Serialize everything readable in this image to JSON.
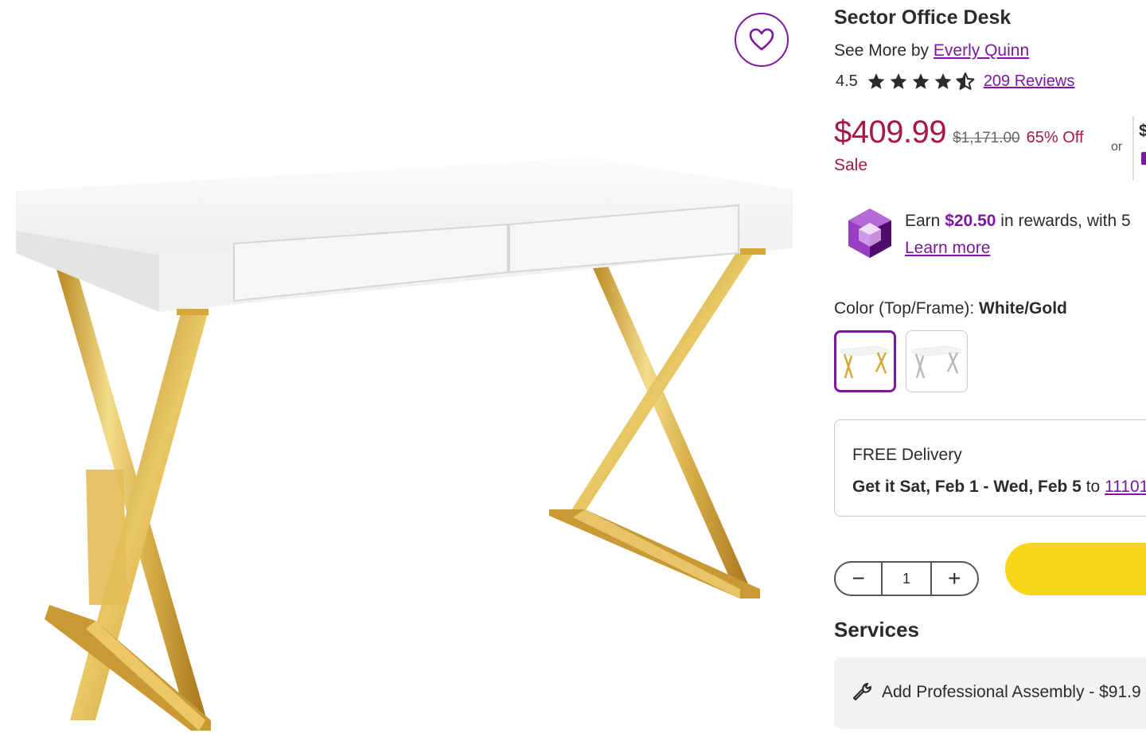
{
  "product": {
    "title": "Sector Office Desk",
    "see_more_prefix": "See More by",
    "brand": "Everly Quinn",
    "rating_value": "4.5",
    "rating_stars": 4.5,
    "reviews_label": "209 Reviews"
  },
  "pricing": {
    "price": "$409.99",
    "original_price": "$1,171.00",
    "discount": "65% Off",
    "sale_label": "Sale",
    "or_label": "or",
    "cut_off_text": "$"
  },
  "rewards": {
    "earn_prefix": "Earn",
    "amount": "$20.50",
    "earn_suffix": "in rewards, with 5",
    "learn_more": "Learn more"
  },
  "options": {
    "color_label": "Color (Top/Frame):",
    "color_value": "White/Gold"
  },
  "delivery": {
    "title": "FREE Delivery",
    "get_it_prefix": "Get it",
    "dates": "Sat, Feb 1 - Wed, Feb 5",
    "to_label": "to",
    "zip": "11101"
  },
  "quantity": {
    "minus": "−",
    "value": "1",
    "plus": "+"
  },
  "services": {
    "heading": "Services",
    "assembly": "Add Professional Assembly - $91.9"
  },
  "icons": {
    "favorite": "heart-icon",
    "star": "star-icon",
    "gem": "rewards-gem-icon",
    "wrench": "wrench-icon"
  },
  "colors": {
    "brand_purple": "#7b189f",
    "sale_red": "#a7174a",
    "cart_yellow": "#f7d51b",
    "gold": "#d4a93a"
  }
}
